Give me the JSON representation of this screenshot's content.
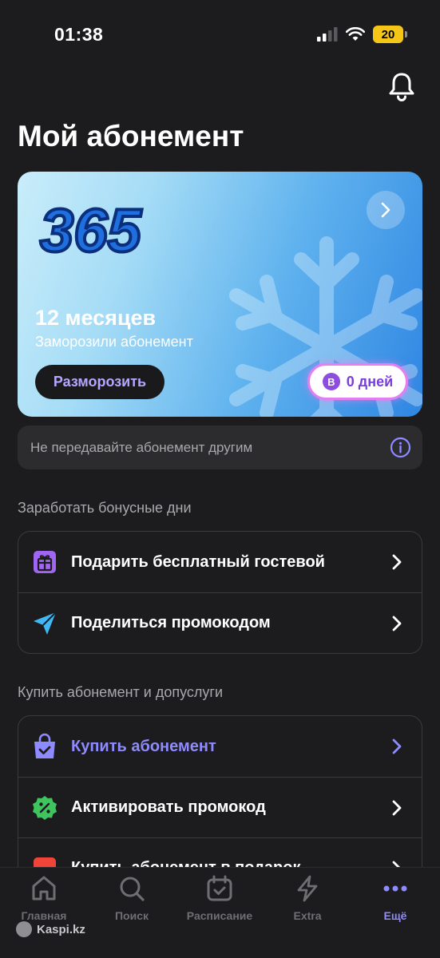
{
  "status_bar": {
    "time": "01:38",
    "battery": "20"
  },
  "header": {
    "title": "Мой абонемент"
  },
  "subscription": {
    "logo_text": "365",
    "period": "12 месяцев",
    "status": "Заморозили абонемент",
    "unfreeze_label": "Разморозить",
    "bonus_icon": "В",
    "days": "0 дней",
    "colors": {
      "gradient_start": "#c9edfa",
      "gradient_end": "#2f86e2",
      "pill_border": "#e47ff0"
    }
  },
  "notice": {
    "text": "Не передавайте абонемент другим"
  },
  "earn_section": {
    "title": "Заработать бонусные дни",
    "items": [
      {
        "label": "Подарить бесплатный гостевой",
        "icon": "gift-icon"
      },
      {
        "label": "Поделиться промокодом",
        "icon": "send-icon"
      }
    ]
  },
  "buy_section": {
    "title": "Купить абонемент и допуслуги",
    "items": [
      {
        "label": "Купить абонемент",
        "icon": "shopping-bag-icon"
      },
      {
        "label": "Активировать промокод",
        "icon": "discount-badge-icon"
      },
      {
        "label": "Купить абонемент в подарок",
        "icon": "gift-box-icon"
      }
    ]
  },
  "tab_bar": {
    "tabs": [
      {
        "label": "Главная",
        "icon": "home-icon"
      },
      {
        "label": "Поиск",
        "icon": "search-icon"
      },
      {
        "label": "Расписание",
        "icon": "calendar-icon"
      },
      {
        "label": "Extra",
        "icon": "lightning-icon"
      },
      {
        "label": "Ещё",
        "icon": "more-icon",
        "active": true
      }
    ]
  },
  "watermark": {
    "text": "Kaspi.kz"
  },
  "accent_color": "#8e8aff"
}
